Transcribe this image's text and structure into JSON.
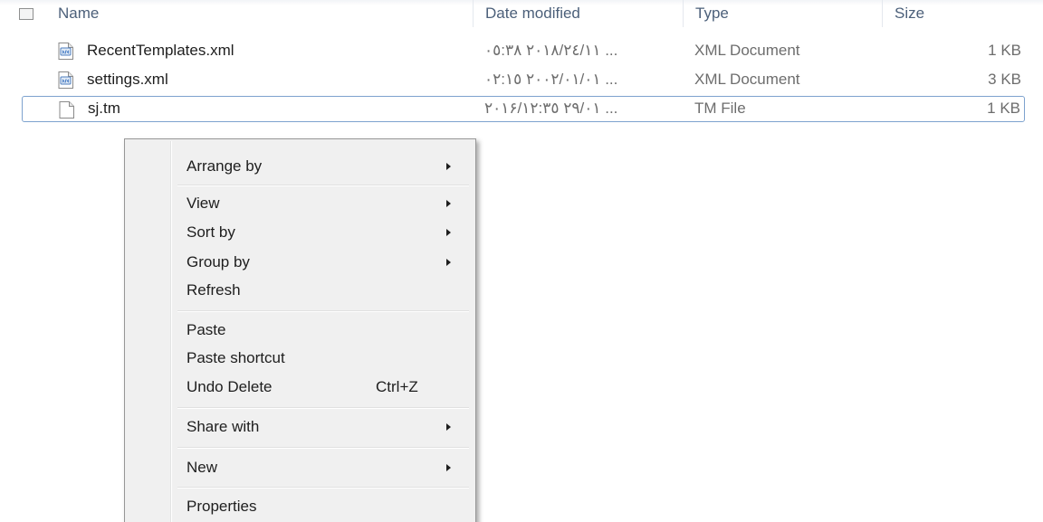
{
  "columns": {
    "name": "Name",
    "date_modified": "Date modified",
    "type": "Type",
    "size": "Size"
  },
  "files": [
    {
      "name": "RecentTemplates.xml",
      "date": "٢٠١٨/٢٤/١١ ٠٥:٣٨ ...",
      "type": "XML Document",
      "size": "1 KB",
      "icon": "xml-file-icon",
      "selected": false
    },
    {
      "name": "settings.xml",
      "date": "٢٠٠٢/٠١/٠١ ٠٢:١٥ ...",
      "type": "XML Document",
      "size": "3 KB",
      "icon": "xml-file-icon",
      "selected": false
    },
    {
      "name": "sj.tm",
      "date": "٢٠١۶/٢٩/٠١ ١٢:٣٥ ...",
      "type": "TM File",
      "size": "1 KB",
      "icon": "blank-file-icon",
      "selected": true
    }
  ],
  "context_menu": {
    "arrange_by": "Arrange by",
    "view": "View",
    "sort_by": "Sort by",
    "group_by": "Group by",
    "refresh": "Refresh",
    "paste": "Paste",
    "paste_shortcut": "Paste shortcut",
    "undo_delete": "Undo Delete",
    "undo_delete_shortcut": "Ctrl+Z",
    "share_with": "Share with",
    "new": "New",
    "properties": "Properties"
  },
  "colors": {
    "selection_border": "#7da2ce",
    "header_text": "#4c607a",
    "menu_background": "#f0f0f0"
  }
}
